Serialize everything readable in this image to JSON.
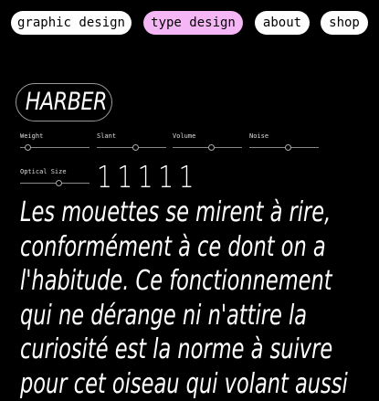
{
  "nav": {
    "items": [
      {
        "label": "graphic design",
        "active": false
      },
      {
        "label": "type design",
        "active": true
      },
      {
        "label": "about",
        "active": false
      },
      {
        "label": "shop",
        "active": false
      }
    ],
    "active_color": "#f4b6f4"
  },
  "typeface": {
    "name": "HARBER"
  },
  "controls": {
    "weight": {
      "label": "Weight",
      "value": 0.1
    },
    "slant": {
      "label": "Slant",
      "value": 0.55
    },
    "volume": {
      "label": "Volume",
      "value": 0.55
    },
    "noise": {
      "label": "Noise",
      "value": 0.55
    },
    "optical_size": {
      "label": "Optical Size",
      "value": 0.55
    }
  },
  "sample": {
    "numbers": "11111",
    "lines": [
      "Les mouettes se mirent à rire,",
      "conformément à ce dont on a",
      "l'habitude. Ce fonctionnement",
      "qui ne dérange ni n'attire la",
      "curiosité est la norme à suivre",
      "pour cet oiseau qui volant aussi"
    ]
  }
}
